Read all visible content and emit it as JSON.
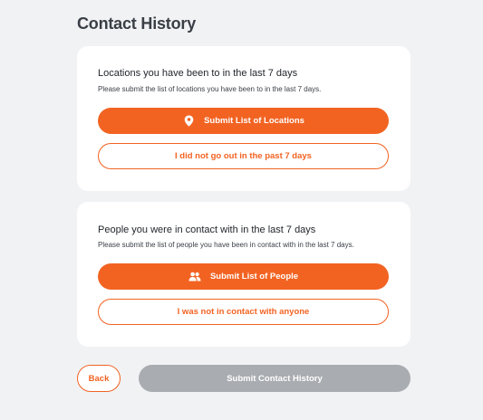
{
  "page": {
    "title": "Contact History"
  },
  "locations": {
    "heading": "Locations you have been to in the last 7 days",
    "subtext": "Please submit the list of locations you have been to in the last 7 days.",
    "submit_label": "Submit List of Locations",
    "submit_icon": "map-pin-icon",
    "none_label": "I did not go out in the past 7 days"
  },
  "people": {
    "heading": "People you were in contact with in the last 7 days",
    "subtext": "Please submit the list of people you have been in contact with in the last 7 days.",
    "submit_label": "Submit List of People",
    "submit_icon": "people-icon",
    "none_label": "I was not in contact with anyone"
  },
  "footer": {
    "back_label": "Back",
    "submit_label": "Submit Contact History",
    "submit_disabled": true
  },
  "colors": {
    "accent": "#f26322",
    "disabled": "#a9acb0",
    "background": "#f1f2f4",
    "card": "#ffffff"
  }
}
